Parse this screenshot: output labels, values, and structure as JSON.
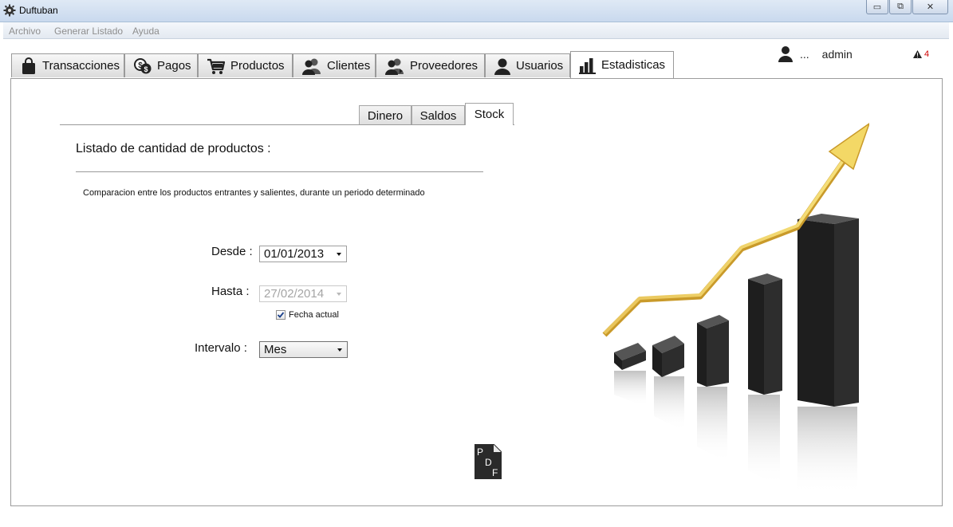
{
  "window": {
    "title": "Duftuban",
    "buttons": {
      "minimize": "▭",
      "restore": "⧉",
      "close": "✕"
    }
  },
  "menu": [
    "Archivo",
    "Generar Listado",
    "Ayuda"
  ],
  "tabs": [
    "Transacciones",
    "Pagos",
    "Productos",
    "Clientes",
    "Proveedores",
    "Usuarios",
    "Estadisticas"
  ],
  "active_tab": "Estadisticas",
  "user": {
    "dots": "...",
    "name": "admin"
  },
  "alerts": {
    "count": "4",
    "color": "#d00000"
  },
  "subtabs": [
    "Dinero",
    "Saldos",
    "Stock"
  ],
  "active_subtab": "Stock",
  "form": {
    "heading": "Listado de cantidad de productos :",
    "description": "Comparacion entre los productos entrantes y salientes, durante un periodo determinado",
    "desde_label": "Desde :",
    "desde_value": "01/01/2013",
    "hasta_label": "Hasta :",
    "hasta_value": "27/02/2014",
    "fecha_actual_label": "Fecha actual",
    "fecha_actual_checked": true,
    "intervalo_label": "Intervalo :",
    "intervalo_value": "Mes"
  },
  "pdf_icon_letters": [
    "P",
    "D",
    "F"
  ],
  "decoration": {
    "image": "bar-chart-growth-illustration"
  }
}
